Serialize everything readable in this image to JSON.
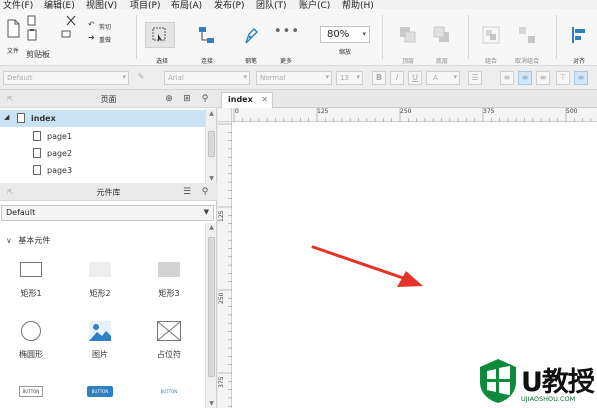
{
  "menu": {
    "items": [
      "文件(F)",
      "编辑(E)",
      "视图(V)",
      "项目(P)",
      "布局(A)",
      "发布(P)",
      "团队(T)",
      "账户(C)",
      "帮助(H)"
    ]
  },
  "toolbar": {
    "file": "文件",
    "clipboard": "剪贴板",
    "cut": "剪切",
    "repeat": "重做",
    "select": "选择",
    "connect": "连接",
    "pen": "钢笔",
    "more": "更多",
    "zoom_value": "80%",
    "zoom_label": "缩放",
    "top": "顶层",
    "bottom": "底层",
    "group": "组合",
    "ungroup": "取消组合",
    "align": "对齐"
  },
  "format": {
    "style": "Default",
    "font": "Arial",
    "weight": "Normal",
    "size": "13",
    "bold": "B",
    "italic": "I",
    "underline": "U",
    "font_color": "A"
  },
  "pages_panel": {
    "title": "页面",
    "items": [
      {
        "label": "index"
      },
      {
        "label": "page1"
      },
      {
        "label": "page2"
      },
      {
        "label": "page3"
      }
    ]
  },
  "library_panel": {
    "title": "元件库",
    "selected_library": "Default",
    "group": "基本元件",
    "widgets": [
      {
        "label": "矩形1",
        "icon": "rectangle-outline-icon"
      },
      {
        "label": "矩形2",
        "icon": "rectangle-light-icon"
      },
      {
        "label": "矩形3",
        "icon": "rectangle-gray-icon"
      },
      {
        "label": "椭圆形",
        "icon": "ellipse-icon"
      },
      {
        "label": "图片",
        "icon": "image-icon"
      },
      {
        "label": "占位符",
        "icon": "placeholder-icon"
      },
      {
        "label": "BUTTON",
        "icon": "button-plain-icon"
      },
      {
        "label": "BUTTON",
        "icon": "button-primary-icon"
      },
      {
        "label": "BUTTON",
        "icon": "button-link-icon"
      }
    ]
  },
  "canvas": {
    "tab": "index",
    "ruler_h": [
      "0",
      "125",
      "250",
      "375",
      "500"
    ],
    "ruler_v": [
      "125",
      "250",
      "375"
    ]
  },
  "watermark": {
    "title": "U教授",
    "url": "UJIAOSHOU.COM"
  },
  "colors": {
    "accent_blue": "#2e7fc4",
    "selection": "#c9e3f5",
    "arrow_red": "#e5332a",
    "watermark_green": "#0f8a3c"
  }
}
